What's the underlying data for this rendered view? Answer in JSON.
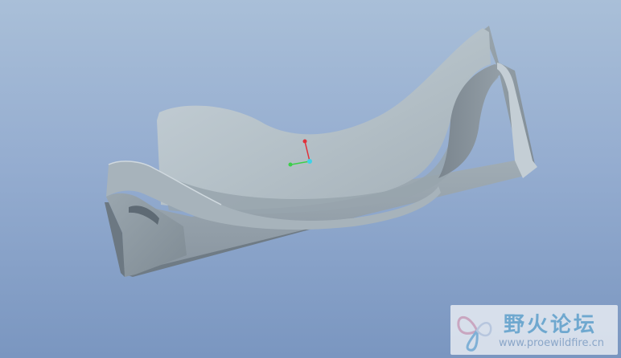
{
  "viewport": {
    "background_top": "#a9bfd8",
    "background_bottom": "#7a96c0",
    "model_color": "#aeb9c0"
  },
  "triad": {
    "x_axis_color": "#e0303a",
    "y_axis_color": "#3ccf4a",
    "origin_color": "#3fd2e8"
  },
  "watermark": {
    "title": "野火论坛",
    "url": "www.proewildfire.cn",
    "logo": "butterfly-logo"
  }
}
